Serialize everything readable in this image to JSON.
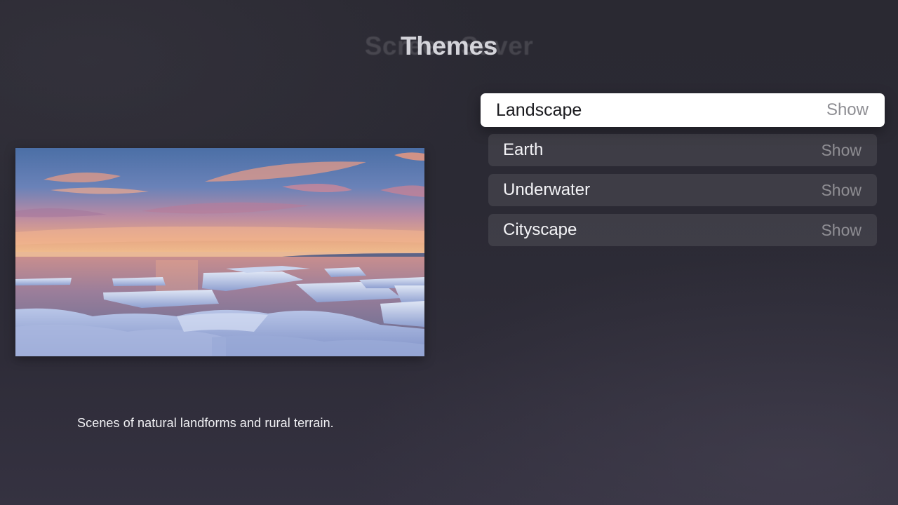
{
  "header": {
    "title": "Themes",
    "previous_title": "Screen Saver"
  },
  "preview": {
    "image_description": "landscape",
    "description": "Scenes of natural landforms and rural terrain."
  },
  "menu": {
    "items": [
      {
        "label": "Landscape",
        "value": "Show",
        "focused": true
      },
      {
        "label": "Earth",
        "value": "Show",
        "focused": false
      },
      {
        "label": "Underwater",
        "value": "Show",
        "focused": false
      },
      {
        "label": "Cityscape",
        "value": "Show",
        "focused": false
      }
    ]
  },
  "colors": {
    "background": "#2b2a34",
    "focused_item": "#ffffff",
    "item_background": "rgba(255,255,255,0.09)",
    "value_text": "#8e8e93"
  }
}
